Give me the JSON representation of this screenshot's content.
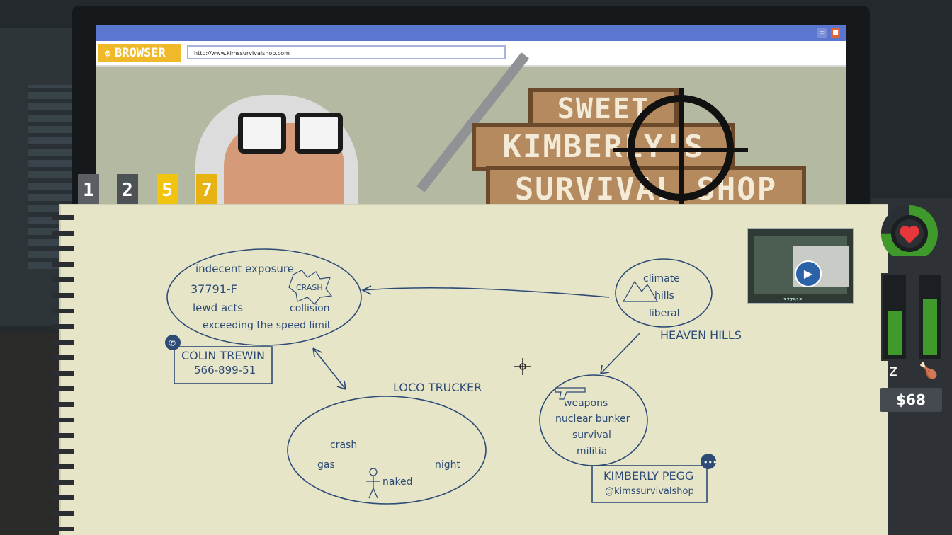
{
  "browser": {
    "tab_label": "BROWSER",
    "url": "http://www.kimssurvivalshop.com",
    "min_glyph": "▭",
    "close_glyph": "■"
  },
  "website": {
    "sign_lines": [
      "SWEET",
      "KIMBERLY'S",
      "SURVIVAL SHOP"
    ]
  },
  "tabs": [
    "1",
    "2",
    "5",
    "7"
  ],
  "active_tab": "5",
  "board": {
    "crash_bubble": {
      "items": [
        "indecent exposure",
        "37791-F",
        "lewd acts",
        "collision",
        "exceeding the speed limit"
      ],
      "badge": "CRASH"
    },
    "contact_card": {
      "name": "COLIN TREWIN",
      "phone": "566-899-51"
    },
    "truck_bubble": {
      "title": "LOCO TRUCKER",
      "items": [
        "crash",
        "gas",
        "night",
        "naked"
      ]
    },
    "heaven_bubble": {
      "items": [
        "climate",
        "hills",
        "liberal"
      ],
      "title": "HEAVEN HILLS"
    },
    "shop_bubble": {
      "items": [
        "weapons",
        "nuclear bunker",
        "survival",
        "militia"
      ]
    },
    "shop_card": {
      "name": "KIMBERLY PEGG",
      "handle": "@kimssurvivalshop"
    }
  },
  "video": {
    "stat": "37791F",
    "icon": "play-icon"
  },
  "hud": {
    "health_level": 0.75,
    "sleep_level": 0.62,
    "hunger_level": 0.78,
    "money": "$68",
    "colors": {
      "good": "#3f9a2b",
      "heart": "#e8373a",
      "accent": "#f1c40f"
    }
  }
}
